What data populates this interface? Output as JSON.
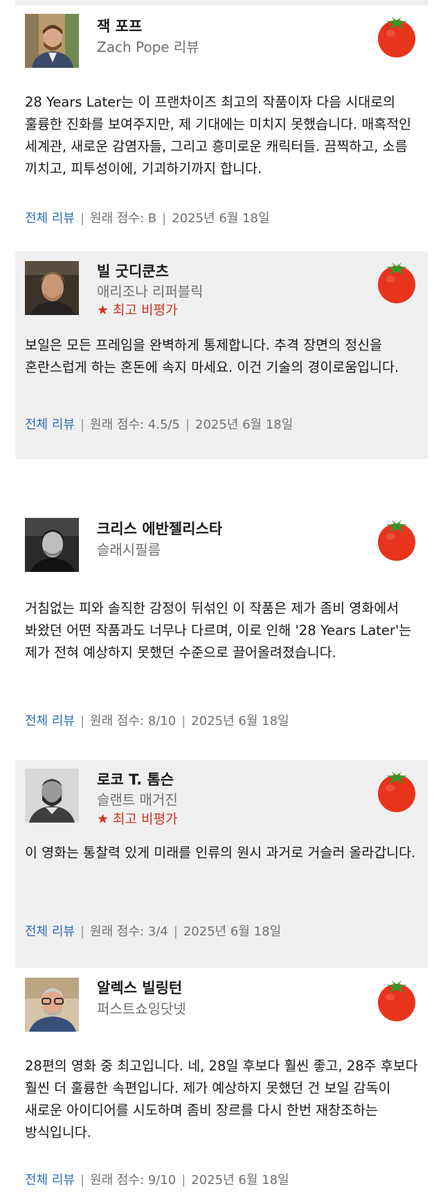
{
  "reviews": [
    {
      "critic_name": "잭 포프",
      "publication": "Zach Pope 리뷰",
      "top_critic": "",
      "quote": "28 Years Later는 이 프랜차이즈 최고의 작품이자 다음 시대로의 훌륭한 진화를 보여주지만, 제 기대에는 미치지 못했습니다. 매혹적인 세계관, 새로운 감염자들, 그리고 흥미로운 캐릭터들. 끔찍하고, 소름 끼치고, 피투성이에, 기괴하기까지 합니다.",
      "full_review": "전체 리뷰",
      "original_score": "원래 점수: B",
      "date": "2025년 6월 18일"
    },
    {
      "critic_name": "빌 굿디쿤츠",
      "publication": "애리조나 리퍼블릭",
      "top_critic": "최고 비평가",
      "quote": "보일은 모든 프레임을 완벽하게 통제합니다. 추격 장면의 정신을 혼란스럽게 하는 혼돈에 속지 마세요. 이건 기술의 경이로움입니다.",
      "full_review": "전체 리뷰",
      "original_score": "원래 점수: 4.5/5",
      "date": "2025년 6월 18일"
    },
    {
      "critic_name": "크리스 에반젤리스타",
      "publication": "슬래시필름",
      "top_critic": "",
      "quote": "거침없는 피와 솔직한 감정이 뒤섞인 이 작품은 제가 좀비 영화에서 봐왔던 어떤 작품과도 너무나 다르며, 이로 인해 '28 Years Later'는 제가 전혀 예상하지 못했던 수준으로 끌어올려졌습니다.",
      "full_review": "전체 리뷰",
      "original_score": "원래 점수: 8/10",
      "date": "2025년 6월 18일"
    },
    {
      "critic_name": "로코 T. 톰슨",
      "publication": "슬랜트 매거진",
      "top_critic": "최고 비평가",
      "quote": "이 영화는 통찰력 있게 미래를 인류의 원시 과거로 거슬러 올라갑니다.",
      "full_review": "전체 리뷰",
      "original_score": "원래 점수: 3/4",
      "date": "2025년 6월 18일"
    },
    {
      "critic_name": "알렉스 빌링턴",
      "publication": "퍼스트쇼잉닷넷",
      "top_critic": "",
      "quote": "28편의 영화 중 최고입니다. 네, 28일 후보다 훨씬 좋고, 28주 후보다 훨씬 더 훌륭한 속편입니다. 제가 예상하지 못했던 건 보일 감독이 새로운 아이디어를 시도하며 좀비 장르를 다시 한번 재창조하는 방식입니다.",
      "full_review": "전체 리뷰",
      "original_score": "원래 점수: 9/10",
      "date": "2025년 6월 18일"
    }
  ],
  "icons": {
    "tomato": "fresh-tomato-icon",
    "star": "star-icon",
    "star_glyph": "★"
  },
  "colors": {
    "link": "#2a6ebd",
    "top_critic": "#d0311e",
    "tomato_red": "#e8341c",
    "tomato_stem": "#2f9a2a",
    "card_shade": "#f0f0f0"
  }
}
